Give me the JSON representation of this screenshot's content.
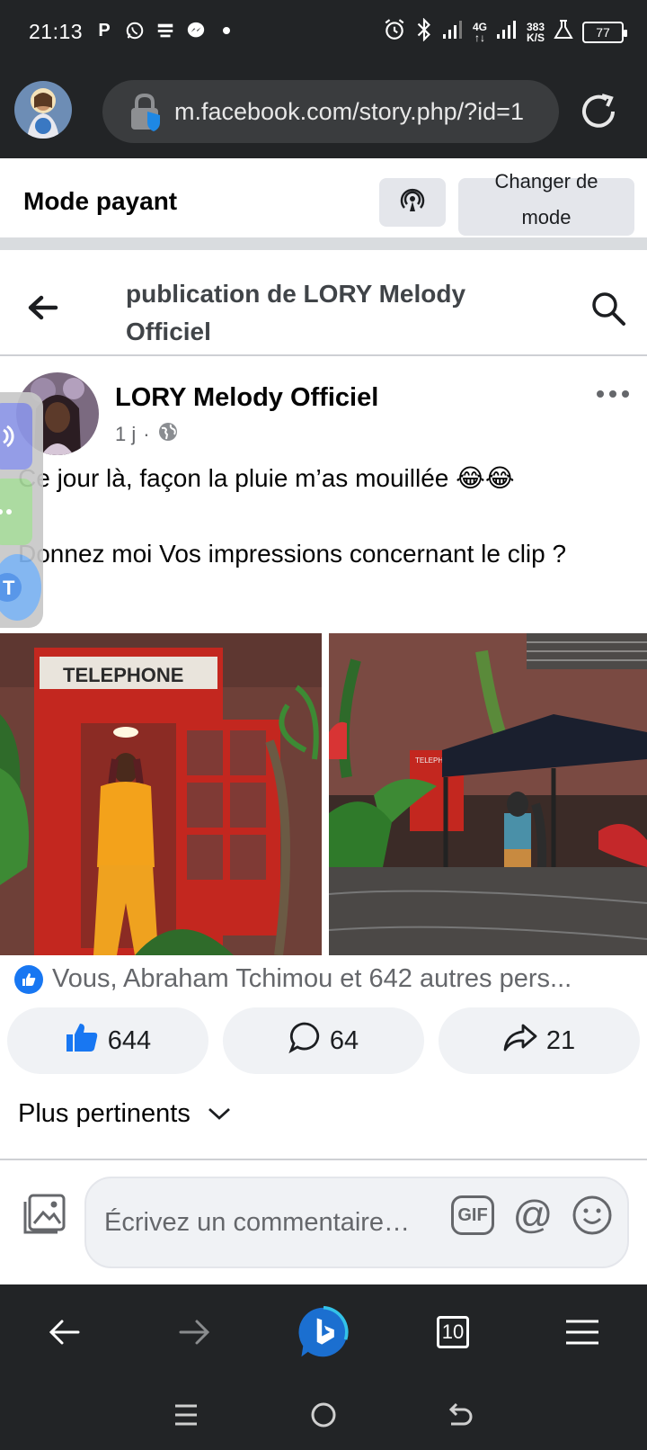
{
  "status_bar": {
    "time": "21:13",
    "left_icons": [
      "parking-icon",
      "whatsapp-icon",
      "news-icon",
      "messenger-icon",
      "dot-icon"
    ],
    "net_type": "4G",
    "speed_value": "383",
    "speed_unit": "K/S",
    "battery": "77"
  },
  "browser": {
    "url": "m.facebook.com/story.php/?id=1"
  },
  "mode_bar": {
    "title": "Mode payant",
    "change_label_1": "Changer de",
    "change_label_2": "mode"
  },
  "page_header": {
    "title": "publication de LORY Melody Officiel"
  },
  "post": {
    "author": "LORY Melody Officiel",
    "time": "1 j",
    "text_line_1": "Ce jour là, façon la pluie m’as mouillée 😂😂",
    "text_line_2": "Donnez moi Vos impressions concernant le clip ?",
    "photo_1_sign": "TELEPHONE",
    "photo_2_sign": "TELEPHONE",
    "reactions_summary": "Vous, Abraham Tchimou et 642 autres pers...",
    "likes": "644",
    "comments": "64",
    "shares": "21",
    "sort_label": "Plus pertinents"
  },
  "comment_composer": {
    "placeholder": "Écrivez un commentaire…",
    "gif_label": "GIF",
    "at_label": "@"
  },
  "toolbar": {
    "tab_count": "10"
  },
  "colors": {
    "facebook_blue": "#1877f2",
    "dark_chrome": "#222426",
    "muted_text": "#65676b"
  }
}
